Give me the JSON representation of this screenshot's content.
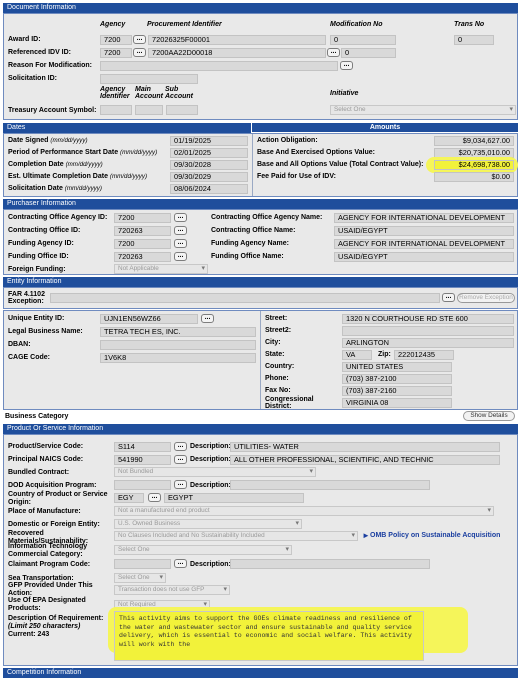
{
  "sections": {
    "document": "Document Information",
    "dates": "Dates",
    "amounts": "Amounts",
    "purchaser": "Purchaser Information",
    "entity": "Entity Information",
    "business": "Business Category",
    "product": "Product Or Service Information",
    "competition": "Competition Information"
  },
  "document": {
    "col_agency": "Agency",
    "col_proc": "Procurement Identifier",
    "col_mod": "Modification No",
    "col_trans": "Trans No",
    "award_id_label": "Award ID:",
    "award_agency": "7200",
    "award_proc": "72026325F00001",
    "award_mod": "0",
    "award_trans": "0",
    "ref_idv_label": "Referenced IDV ID:",
    "ref_agency": "7200",
    "ref_proc": "7200AA22D00018",
    "ref_mod": "0",
    "reason_label": "Reason For Modification:",
    "solicitation_label": "Solicitation ID:",
    "col_agency_id": "Agency Identifier",
    "col_main": "Main Account",
    "col_sub": "Sub Account",
    "col_initiative": "Initiative",
    "treasury_label": "Treasury Account Symbol:",
    "initiative_value": "Select One"
  },
  "dates": {
    "signed_label": "Date Signed",
    "signed_fmt": "(mm/dd/yyyy)",
    "signed": "01/19/2025",
    "pop_start_label": "Period of Performance Start Date",
    "pop_start_fmt": "(mm/dd/yyyy)",
    "pop_start": "02/01/2025",
    "completion_label": "Completion Date",
    "completion_fmt": "(mm/dd/yyyy)",
    "completion": "09/30/2028",
    "ultimate_label": "Est. Ultimate Completion Date",
    "ultimate_fmt": "(mm/dd/yyyy)",
    "ultimate": "09/30/2029",
    "solicit_label": "Solicitation Date",
    "solicit_fmt": "(mm/dd/yyyy)",
    "solicit": "08/06/2024"
  },
  "amounts": {
    "obligation_label": "Action Obligation:",
    "obligation": "$9,034,627.00",
    "base_exercised_label": "Base And Exercised Options Value:",
    "base_exercised": "$20,735,010.00",
    "base_all_label": "Base and All Options Value (Total Contract Value):",
    "base_all": "$24,698,738.00",
    "fee_label": "Fee Paid for Use of IDV:",
    "fee": "$0.00"
  },
  "purchaser": {
    "co_agency_id_label": "Contracting Office Agency ID:",
    "co_agency_id": "7200",
    "co_agency_name_label": "Contracting Office Agency Name:",
    "co_agency_name": "AGENCY FOR INTERNATIONAL DEVELOPMENT",
    "co_id_label": "Contracting Office ID:",
    "co_id": "720263",
    "co_name_label": "Contracting Office Name:",
    "co_name": "USAID/EGYPT",
    "fa_id_label": "Funding Agency ID:",
    "fa_id": "7200",
    "fa_name_label": "Funding Agency Name:",
    "fa_name": "AGENCY FOR INTERNATIONAL DEVELOPMENT",
    "fo_id_label": "Funding Office ID:",
    "fo_id": "720263",
    "fo_name_label": "Funding Office Name:",
    "fo_name": "USAID/EGYPT",
    "foreign_label": "Foreign Funding:",
    "foreign_value": "Not Applicable"
  },
  "entity": {
    "far_label": "FAR 4.1102 Exception:",
    "remove_exception": "Remove Exception",
    "uei_label": "Unique Entity ID:",
    "uei": "UJN1EN56WZ66",
    "legal_label": "Legal Business Name:",
    "legal": "TETRA TECH ES, INC.",
    "dban_label": "DBAN:",
    "cage_label": "CAGE Code:",
    "cage": "1V6K8",
    "street_label": "Street:",
    "street": "1320 N COURTHOUSE RD STE 600",
    "street2_label": "Street2:",
    "city_label": "City:",
    "city": "ARLINGTON",
    "state_label": "State:",
    "state": "VA",
    "zip_label": "Zip:",
    "zip": "222012435",
    "country_label": "Country:",
    "country": "UNITED STATES",
    "phone_label": "Phone:",
    "phone": "(703) 387-2100",
    "fax_label": "Fax No:",
    "fax": "(703) 387-2160",
    "district_label": "Congressional District:",
    "district": "VIRGINIA 08",
    "show_details": "Show Details"
  },
  "product": {
    "psc_label": "Product/Service Code:",
    "psc": "S114",
    "desc_label": "Description:",
    "psc_desc": "UTILITIES- WATER",
    "naics_label": "Principal NAICS Code:",
    "naics": "541990",
    "naics_desc": "ALL OTHER PROFESSIONAL, SCIENTIFIC, AND TECHNIC",
    "bundled_label": "Bundled Contract:",
    "bundled": "Not Bundled",
    "dod_label": "DOD Acquisition Program:",
    "dod_desc_label": "Description:",
    "country_label": "Country of Product or Service Origin:",
    "country_code": "EGY",
    "country_name": "EGYPT",
    "place_label": "Place of Manufacture:",
    "place": "Not a manufactured end product",
    "domestic_label": "Domestic or Foreign Entity:",
    "domestic": "U.S. Owned Business",
    "recovered_label": "Recovered Materials/Sustainability:",
    "recovered": "No Clauses Included and No Sustainability Included",
    "omb_link": "OMB Policy on Sustainable Acquisition",
    "itc_label": "Information Technology Commercial Category:",
    "itc": "Select One",
    "claimant_label": "Claimant Program Code:",
    "claimant_desc_label": "Description:",
    "sea_label": "Sea Transportation:",
    "sea": "Select One",
    "gfp_label": "GFP Provided Under This Action:",
    "gfp": "Transaction does not use GFP",
    "epa_label": "Use Of EPA Designated Products:",
    "epa": "Not Required",
    "req_label": "Description Of Requirement:",
    "req_limit": "(Limit 250 characters)",
    "req_current": "Current: 243",
    "req_text": "This activity aims to support the GOEs climate readiness and resilience of the water and wastewater sector and ensure sustainable and quality service delivery, which is essential to economic and social welfare. This activity will work with the"
  }
}
